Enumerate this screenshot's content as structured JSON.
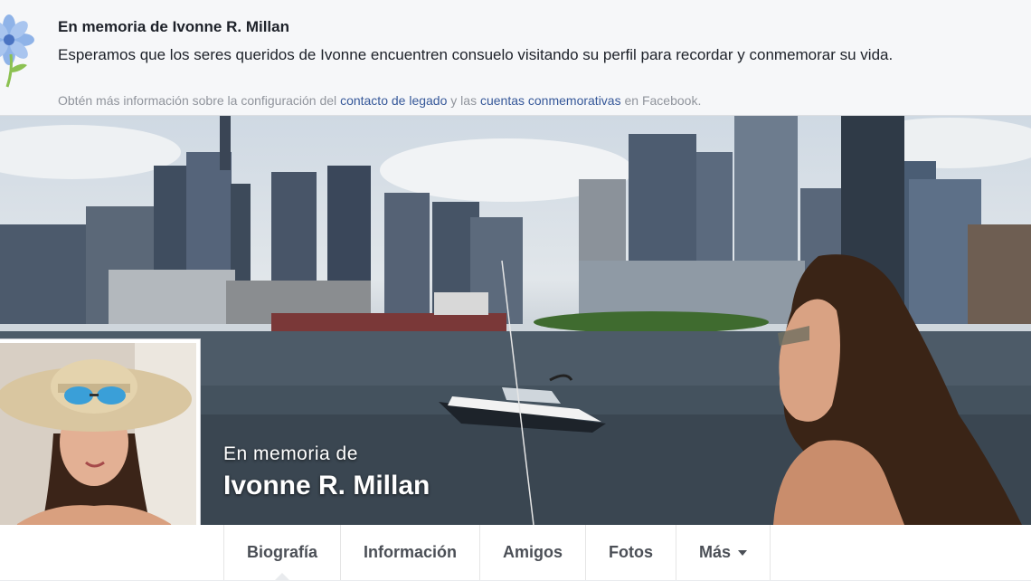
{
  "banner": {
    "title": "En memoria de Ivonne R. Millan",
    "text": "Esperamos que los seres queridos de Ivonne encuentren consuelo visitando su perfil para recordar y conmemorar su vida.",
    "info_prefix": "Obtén más información sobre la configuración del ",
    "link_legacy": "contacto de legado",
    "info_middle": " y las ",
    "link_memorial": "cuentas conmemorativas",
    "info_suffix": " en Facebook."
  },
  "profile": {
    "memorial_label": "En memoria de",
    "name": "Ivonne R. Millan"
  },
  "nav": {
    "tabs": [
      {
        "label": "Biografía",
        "active": true
      },
      {
        "label": "Información"
      },
      {
        "label": "Amigos"
      },
      {
        "label": "Fotos"
      },
      {
        "label": "Más"
      }
    ]
  },
  "colors": {
    "link": "#365899",
    "water": "#3e4c58",
    "background": "#e9ebee"
  },
  "icons": [
    "flower-icon",
    "dropdown-caret-icon"
  ]
}
